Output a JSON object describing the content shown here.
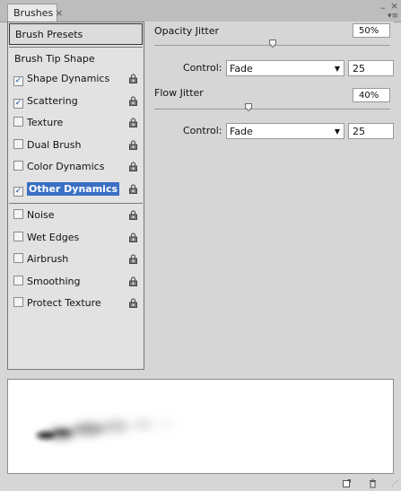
{
  "window": {
    "tab_title": "Brushes",
    "tab_close": "×"
  },
  "left_panel": {
    "presets_label": "Brush Presets",
    "tip_shape_label": "Brush Tip Shape",
    "items": [
      {
        "label": "Shape Dynamics",
        "checked": true,
        "selected": false
      },
      {
        "label": "Scattering",
        "checked": true,
        "selected": false
      },
      {
        "label": "Texture",
        "checked": false,
        "selected": false
      },
      {
        "label": "Dual Brush",
        "checked": false,
        "selected": false
      },
      {
        "label": "Color Dynamics",
        "checked": false,
        "selected": false
      },
      {
        "label": "Other Dynamics",
        "checked": true,
        "selected": true
      },
      {
        "label": "Noise",
        "checked": false,
        "selected": false
      },
      {
        "label": "Wet Edges",
        "checked": false,
        "selected": false
      },
      {
        "label": "Airbrush",
        "checked": false,
        "selected": false
      },
      {
        "label": "Smoothing",
        "checked": false,
        "selected": false
      },
      {
        "label": "Protect Texture",
        "checked": false,
        "selected": false
      }
    ]
  },
  "opacity_jitter": {
    "label": "Opacity Jitter",
    "value": "50%",
    "control_label": "Control:",
    "control_value": "Fade",
    "fade_steps": "25",
    "slider_fraction": 0.5
  },
  "flow_jitter": {
    "label": "Flow Jitter",
    "value": "40%",
    "control_label": "Control:",
    "control_value": "Fade",
    "fade_steps": "25",
    "slider_fraction": 0.4
  },
  "icons": {
    "lock": "lock-icon",
    "new": "new-preset-icon",
    "trash": "trash-icon",
    "menu": "panel-menu-icon"
  },
  "colors": {
    "selection": "#3a6fc4",
    "check": "#1a4fa0"
  }
}
